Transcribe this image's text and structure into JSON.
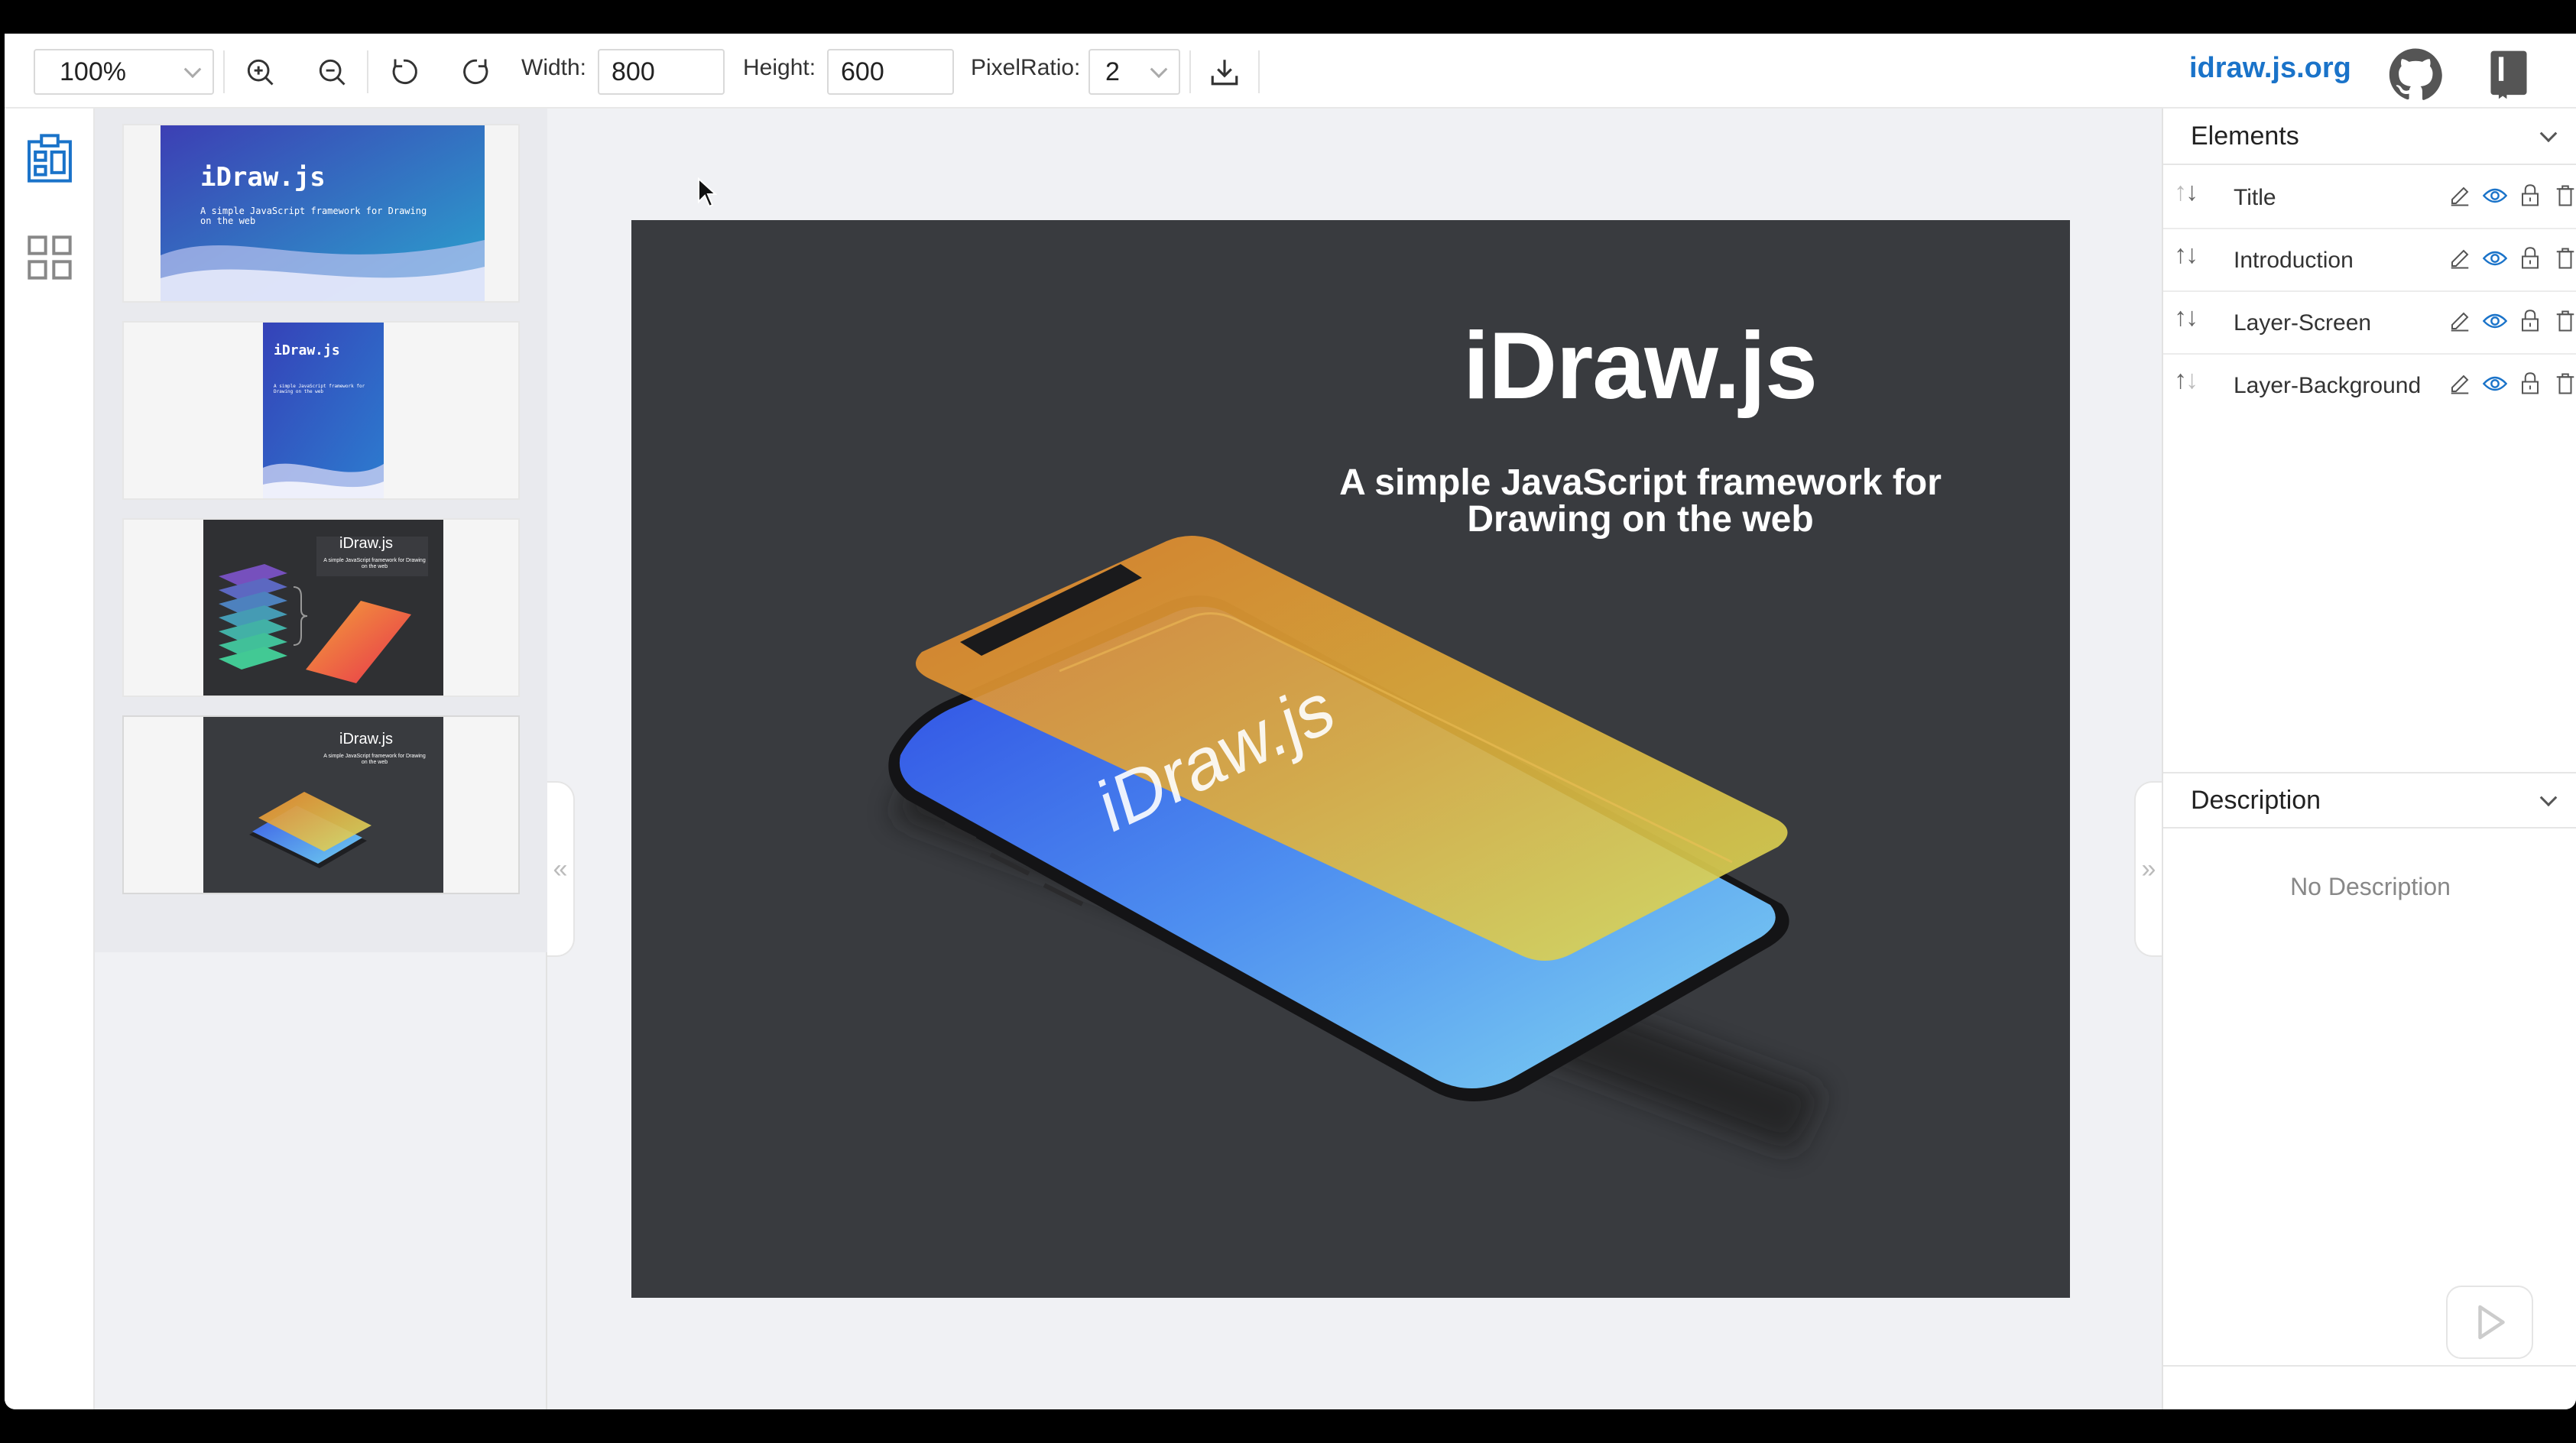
{
  "toolbar": {
    "zoom": "100%",
    "width_label": "Width:",
    "width_value": "800",
    "height_label": "Height:",
    "height_value": "600",
    "pixelratio_label": "PixelRatio:",
    "pixelratio_value": "2",
    "site_link": "idraw.js.org",
    "icons": [
      "zoom-in-icon",
      "zoom-out-icon",
      "undo-icon",
      "redo-icon",
      "download-icon",
      "github-icon",
      "book-icon"
    ]
  },
  "rail": {
    "icons": [
      "layout-icon",
      "grid-icon"
    ]
  },
  "slides": [
    {
      "title": "iDraw.js",
      "subtitle": "A simple JavaScript framework for Drawing on the web"
    },
    {
      "title": "iDraw.js",
      "subtitle": "A simple JavaScript framework for Drawing on the web"
    },
    {
      "title": "iDraw.js",
      "subtitle": "A simple JavaScript framework for Drawing on the web"
    },
    {
      "title": "iDraw.js",
      "subtitle": "A simple JavaScript framework for Drawing on the web"
    }
  ],
  "artboard": {
    "title": "iDraw.js",
    "subtitle_line1": "A simple JavaScript framework for",
    "subtitle_line2": "Drawing on the web",
    "screen_text": "iDraw.js",
    "background": "#393b3f"
  },
  "elements_panel": {
    "title": "Elements",
    "items": [
      {
        "name": "Title"
      },
      {
        "name": "Introduction"
      },
      {
        "name": "Layer-Screen"
      },
      {
        "name": "Layer-Background"
      }
    ]
  },
  "description_panel": {
    "title": "Description",
    "empty_text": "No Description"
  },
  "colors": {
    "accent": "#1a73c9",
    "eye_icon": "#1a73c9",
    "rail_active": "#1a73c9"
  }
}
